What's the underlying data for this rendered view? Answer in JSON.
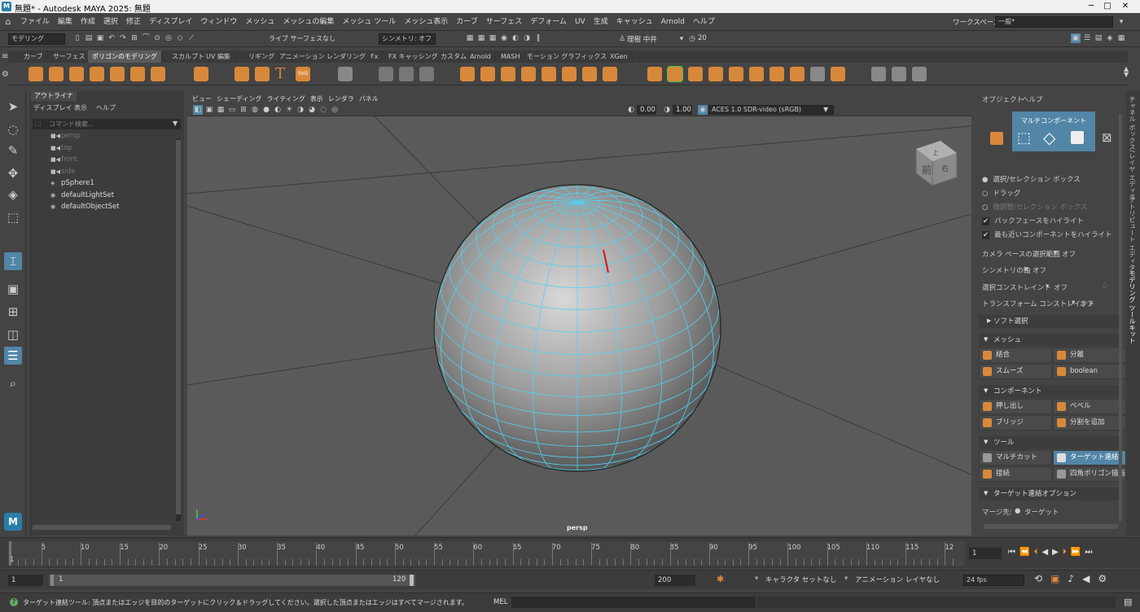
{
  "app": {
    "title": "無題* - Autodesk MAYA 2025: 無題",
    "logo": "M"
  },
  "window_controls": {
    "minimize": "─",
    "maximize": "□",
    "close": "✕"
  },
  "menu": [
    "ファイル",
    "編集",
    "作成",
    "選択",
    "修正",
    "ディスプレイ",
    "ウィンドウ",
    "メッシュ",
    "メッシュの編集",
    "メッシュ ツール",
    "メッシュ表示",
    "カーブ",
    "サーフェス",
    "デフォーム",
    "UV",
    "生成",
    "キャッシュ",
    "Arnold",
    "ヘルプ"
  ],
  "workspace": {
    "label": "ワークスペース:",
    "value": "一般*"
  },
  "status": {
    "mode": "モデリング",
    "live": "ライブ サーフェスなし",
    "symmetry": "シンメトリ: オフ",
    "user": "理樹 中井",
    "count": "20"
  },
  "shelf_tabs": [
    "カーブ",
    "サーフェス",
    "ポリゴンのモデリング",
    "スカルプト",
    "UV 編集",
    "リギング",
    "アニメーション",
    "レンダリング",
    "Fx",
    "FX キャッシング",
    "カスタム",
    "Arnold",
    "MASH",
    "モーション グラフィックス",
    "XGen"
  ],
  "shelf_active": "ポリゴンのモデリング",
  "shelf_text_icons": {
    "type": "T",
    "svg": "SVG"
  },
  "outliner": {
    "tab": "アウトライナ",
    "menu": [
      "ディスプレイ",
      "表示",
      "ヘルプ"
    ],
    "search_placeholder": "コマンド検索...",
    "items": [
      {
        "label": "persp",
        "dim": true,
        "icon": "■◀"
      },
      {
        "label": "top",
        "dim": true,
        "icon": "■◀"
      },
      {
        "label": "front",
        "dim": true,
        "icon": "■◀"
      },
      {
        "label": "side",
        "dim": true,
        "icon": "■◀"
      },
      {
        "label": "pSphere1",
        "dim": false,
        "icon": "◈"
      },
      {
        "label": "defaultLightSet",
        "dim": false,
        "icon": "◉"
      },
      {
        "label": "defaultObjectSet",
        "dim": false,
        "icon": "◉"
      }
    ]
  },
  "viewport": {
    "menu": [
      "ビュー",
      "シェーディング",
      "ライティング",
      "表示",
      "レンダラ",
      "パネル"
    ],
    "exposure": "0.00",
    "gamma": "1.00",
    "colorspace": "ACES 1.0 SDR-video (sRGB)",
    "camera_label": "persp",
    "viewcube": {
      "front": "前",
      "right": "右",
      "top": "上"
    }
  },
  "right_panel": {
    "menu": [
      "オブジェクト",
      "ヘルプ"
    ],
    "multicomp": "マルチコンポーネント",
    "options": [
      {
        "label": "選択/セレクション ボックス",
        "kind": "radio",
        "on": true
      },
      {
        "label": "ドラッグ",
        "kind": "radio",
        "on": false
      },
      {
        "label": "微調整/セレクション ボックス",
        "kind": "radio",
        "on": false,
        "dim": true
      },
      {
        "label": "バックフェースをハイライト",
        "kind": "check",
        "on": true
      },
      {
        "label": "最も近いコンポーネントをハイライト",
        "kind": "check",
        "on": true
      }
    ],
    "camera_select": {
      "label": "カメラ ベースの選択範囲",
      "value": "オフ"
    },
    "symmetry_axis": {
      "label": "シンメトリの軸",
      "value": "オフ"
    },
    "select_constraint": {
      "label": "選択コンストレイント",
      "value": "オフ",
      "num": "0"
    },
    "transform_constraint": {
      "label": "トランスフォーム コンストレイント",
      "value": "オフ"
    },
    "soft_select": "ソフト選択",
    "mesh_section": "メッシュ",
    "mesh_buttons": [
      "結合",
      "分離",
      "スムーズ",
      "boolean"
    ],
    "component_section": "コンポーネント",
    "component_buttons": [
      "押し出し",
      "ベベル",
      "ブリッジ",
      "分割を追加"
    ],
    "tool_section": "ツール",
    "tool_buttons": [
      "マルチカット",
      "ターゲット連結",
      "接続",
      "四角ポリゴン描画"
    ],
    "target_section": "ターゲット連結オプション",
    "merge_label": "マージ先:",
    "merge_value": "ターゲット"
  },
  "side_tabs": [
    "チャネル ボックス/レイヤ エディタ",
    "アトリビュート エディタ",
    "モデリング ツールキット"
  ],
  "timeline": {
    "ticks": [
      "1",
      "5",
      "10",
      "15",
      "20",
      "25",
      "30",
      "35",
      "40",
      "45",
      "50",
      "55",
      "60",
      "65",
      "70",
      "75",
      "80",
      "85",
      "90",
      "95",
      "100",
      "105",
      "110",
      "115",
      "12"
    ],
    "current": "1"
  },
  "range": {
    "start": "1",
    "inner_start": "1",
    "inner_end": "120",
    "end": "200",
    "character": "キャラクタ セットなし",
    "anim_layer": "アニメーション レイヤなし",
    "fps": "24 fps"
  },
  "help": {
    "text": "ターゲット連結ツール: 頂点またはエッジを目的のターゲットにクリック＆ドラッグしてください。選択した頂点またはエッジはすべてマージされます。",
    "mel": "MEL"
  }
}
